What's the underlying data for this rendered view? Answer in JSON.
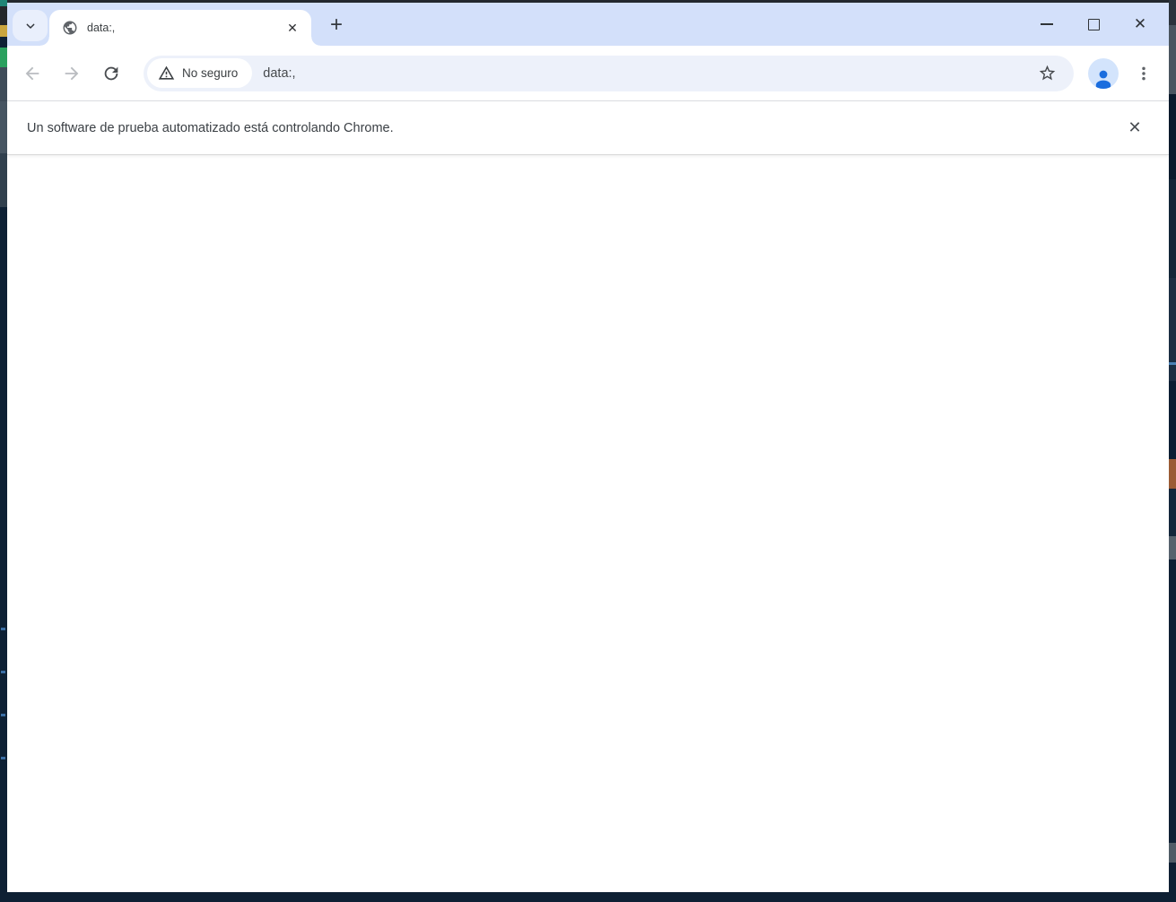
{
  "colors": {
    "tab_strip_bg": "#d3e0fa",
    "tab_search_bg": "#e9effc",
    "toolbar_bg": "#ffffff",
    "omnibox_bg": "#edf1fa",
    "avatar_circle_bg": "#d3e4fc",
    "avatar_person_blue": "#1a6dde",
    "icon_dark_gray": "#3c4043",
    "disabled_icon_gray": "#b9bcc0",
    "desktop_behind_window": "#0e2034"
  },
  "icons": {
    "close_glyph": "✕",
    "plus_glyph": "+",
    "tab_search": "chevron-down",
    "tab_favicon": "globe",
    "back": "arrow-left",
    "forward": "arrow-right",
    "reload": "refresh-arc",
    "security": "warning-triangle-outline",
    "bookmark": "star-outline",
    "profile": "person",
    "menu": "kebab-vertical-dots"
  },
  "tab_strip": {
    "active_tab": {
      "title": "data:,"
    }
  },
  "toolbar": {
    "security_chip_label": "No seguro",
    "url_value": "data:,"
  },
  "infobar": {
    "message": "Un software de prueba automatizado está controlando Chrome."
  }
}
